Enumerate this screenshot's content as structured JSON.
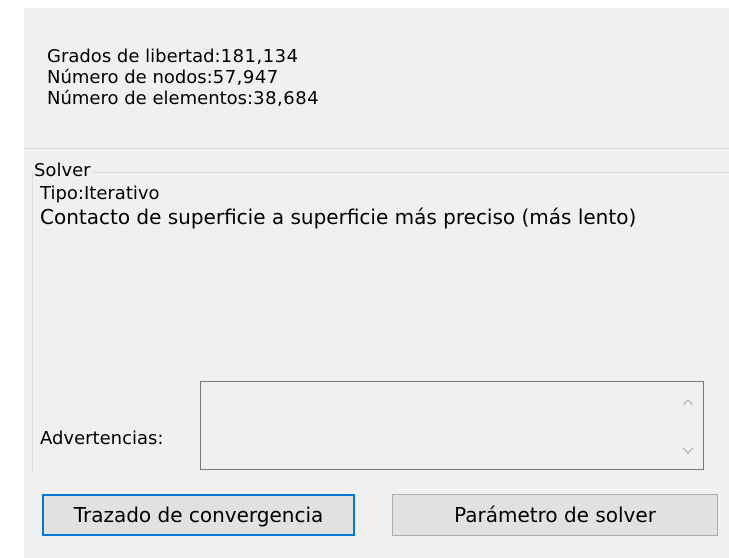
{
  "mesh": {
    "dof_label": "Grados de libertad:",
    "dof_value": "181,134",
    "nodes_label": "Número de nodos:",
    "nodes_value": "57,947",
    "elements_label": "Número de elementos:",
    "elements_value": "38,684"
  },
  "solver": {
    "group_title": "Solver",
    "type_label": "Tipo:",
    "type_value": "Iterativo",
    "contact_text": "Contacto de superficie a superficie más preciso (más lento)"
  },
  "warnings": {
    "label": "Advertencias:",
    "value": ""
  },
  "buttons": {
    "convergence_plot": "Trazado de convergencia",
    "solver_parameter": "Parámetro de solver"
  },
  "colors": {
    "dialog_bg": "#f0f0f0",
    "focus_border": "#0078d7",
    "button_bg": "#e1e1e1"
  },
  "icons": {
    "scroll_up": "chevron-up-icon",
    "scroll_down": "chevron-down-icon"
  }
}
